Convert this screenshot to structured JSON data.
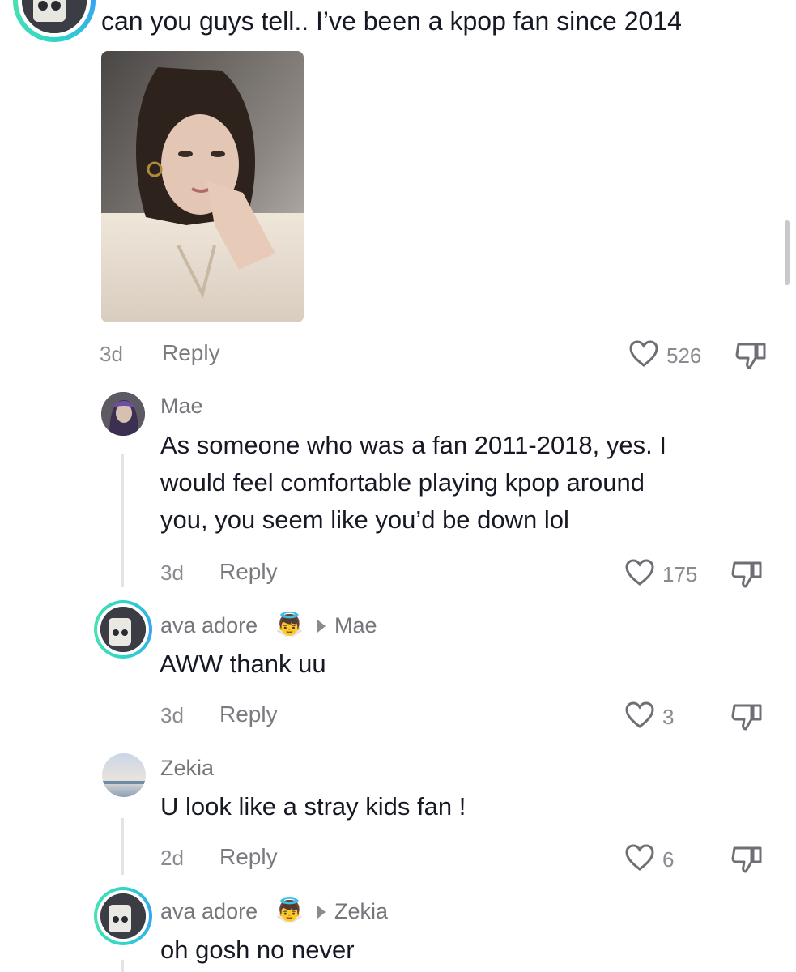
{
  "colors": {
    "text": "#161823",
    "muted": "#8a8b91",
    "ring": "#36a4f2",
    "thread_line": "#e3e3e6"
  },
  "comment_main": {
    "text": "can you guys tell.. I’ve been a kpop fan since 2014",
    "image_alt": "photo",
    "time": "3d",
    "reply": "Reply",
    "likes": "526"
  },
  "replies": [
    {
      "username": "Mae",
      "text_lines": [
        "As someone who was a fan 2011-2018, yes. I",
        "would feel comfortable playing kpop around",
        "you, you seem like you’d be down lol"
      ],
      "time": "3d",
      "reply": "Reply",
      "likes": "175"
    },
    {
      "username": "ava adore",
      "emoji": "👼",
      "reply_to": "Mae",
      "text": "AWW thank uu",
      "time": "3d",
      "reply": "Reply",
      "likes": "3"
    },
    {
      "username": "Zekia",
      "text": "U look like a stray kids fan !",
      "time": "2d",
      "reply": "Reply",
      "likes": "6"
    },
    {
      "username": "ava adore",
      "emoji": "👼",
      "reply_to": "Zekia",
      "text": "oh gosh no never"
    }
  ]
}
